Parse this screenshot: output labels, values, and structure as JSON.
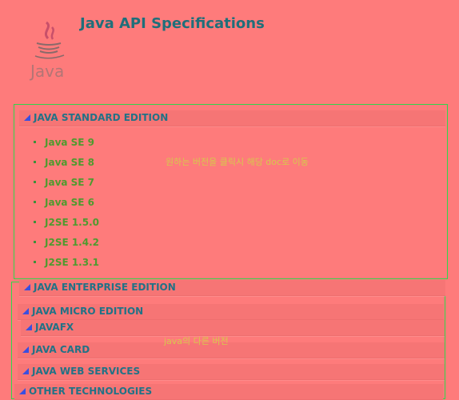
{
  "header": {
    "title": "Java API Specifications",
    "logo_text": "Java"
  },
  "standard": {
    "heading": "JAVA STANDARD EDITION",
    "versions": [
      "Java SE 9",
      "Java SE 8",
      "Java SE 7",
      "Java SE 6",
      "J2SE 1.5.0",
      "J2SE 1.4.2",
      "J2SE 1.3.1"
    ]
  },
  "sections": [
    {
      "label": "JAVA ENTERPRISE EDITION"
    },
    {
      "label": "JAVA MICRO EDITION"
    },
    {
      "label": "JAVAFX"
    },
    {
      "label": "JAVA CARD"
    },
    {
      "label": "JAVA WEB SERVICES"
    },
    {
      "label": "OTHER TECHNOLOGIES"
    }
  ],
  "annotations": {
    "version_note": "원하는 버전을 클릭시 해당 doc로 이동",
    "other_note": "java의 다른 버전"
  },
  "colors": {
    "background": "#fe7b7b",
    "outline": "#2fd64b",
    "heading": "#227286",
    "link": "#4f9a2e"
  }
}
